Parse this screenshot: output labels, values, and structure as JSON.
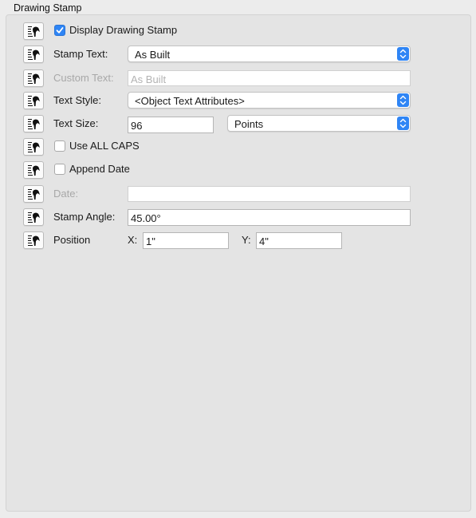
{
  "group": {
    "title": "Drawing Stamp"
  },
  "display_stamp": {
    "label": "Display Drawing Stamp",
    "checked": true
  },
  "stamp_text": {
    "label": "Stamp Text:",
    "value": "As Built"
  },
  "custom_text": {
    "label": "Custom Text:",
    "placeholder": "As Built",
    "enabled": false
  },
  "text_style": {
    "label": "Text Style:",
    "value": "<Object Text Attributes>"
  },
  "text_size": {
    "label": "Text Size:",
    "value": "96",
    "unit": "Points"
  },
  "all_caps": {
    "label": "Use ALL CAPS",
    "checked": false
  },
  "append_date": {
    "label": "Append Date",
    "checked": false
  },
  "date": {
    "label": "Date:",
    "value": "",
    "enabled": false
  },
  "stamp_angle": {
    "label": "Stamp Angle:",
    "value": "45.00°"
  },
  "position": {
    "label": "Position",
    "x_label": "X:",
    "x_value": "1\"",
    "y_label": "Y:",
    "y_value": "4\""
  },
  "icons": {
    "link_button": "link-icon",
    "check": "checkmark-icon",
    "popup_arrows": "chevron-up-down-icon"
  },
  "colors": {
    "accent": "#2f85f5",
    "panel": "#e4e4e4",
    "window": "#ececec",
    "disabled_text": "#a8a8a8"
  }
}
